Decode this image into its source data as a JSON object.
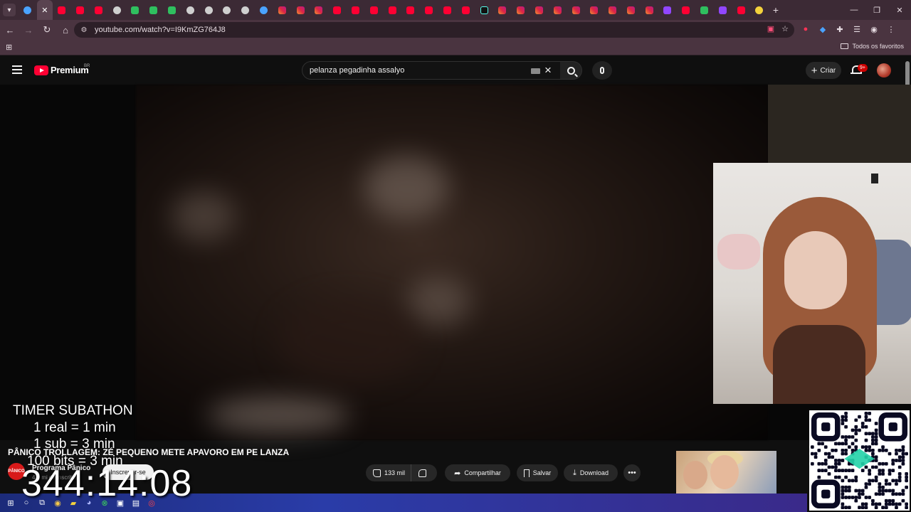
{
  "browser": {
    "url": "youtube.com/watch?v=I9KmZG764J8",
    "bookmarks_folder": "Todos os favoritos",
    "tab_favicons": [
      "blue",
      "active",
      "yt",
      "yt",
      "yt",
      "s",
      "green",
      "green",
      "green",
      "gray",
      "anchor",
      "gray",
      "gray",
      "blue",
      "ig",
      "ig",
      "ig",
      "yt",
      "yt",
      "yt",
      "yt",
      "yt",
      "yt",
      "yt",
      "yt",
      "tk",
      "ig",
      "ig",
      "ig",
      "ig",
      "ig",
      "ig",
      "ig",
      "ig",
      "ig",
      "tw",
      "yt",
      "green",
      "tw",
      "red",
      "yel"
    ]
  },
  "youtube": {
    "logo_text": "Premium",
    "logo_region": "BR",
    "search_query": "pelanza pegadinha assalyo",
    "create_label": "Criar",
    "notifications_badge": "9+"
  },
  "overlay": {
    "timer_title": "TIMER SUBATHON",
    "rules": [
      "1 real = 1 min",
      "1 sub = 3 min",
      "100 bits = 3 min"
    ],
    "countdown": "344:14:08"
  },
  "video": {
    "title": "PÂNICO TROLLAGEM: ZÉ PEQUENO METE APAVORO EM PE LANZA",
    "channel_name": "Programa Pânico",
    "channel_avatar_text": "PÂNICO",
    "channel_subs": "4,2 mi de inscritos",
    "subscribe_label": "Inscrever-se",
    "likes": "133 mil",
    "share_label": "Compartilhar",
    "save_label": "Salvar",
    "download_label": "Download"
  },
  "colors": {
    "chrome_frame": "#3c2a35",
    "yt_red": "#ff0033",
    "bg": "#0f0f0f"
  }
}
